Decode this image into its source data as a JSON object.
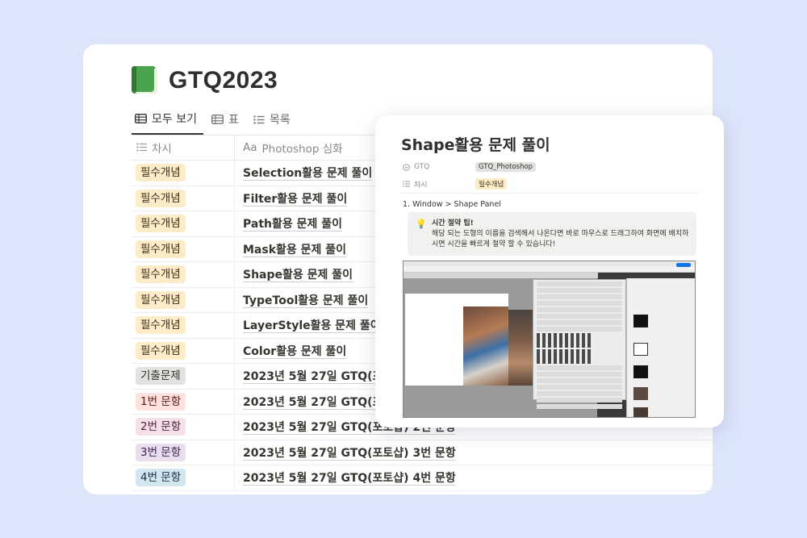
{
  "page": {
    "title": "GTQ2023",
    "icon": "green-book-icon"
  },
  "tabs": [
    {
      "label": "모두 보기",
      "icon": "table-icon",
      "active": true
    },
    {
      "label": "표",
      "icon": "table-icon",
      "active": false
    },
    {
      "label": "목록",
      "icon": "list-icon",
      "active": false
    }
  ],
  "table": {
    "columns": [
      {
        "label": "차시",
        "icon": "list-icon"
      },
      {
        "label": "Photoshop 심화",
        "icon": "text-property-icon",
        "icon_text": "Aa"
      }
    ],
    "rows": [
      {
        "tag": "필수개념",
        "tag_bg": "#fdecc8",
        "tag_fg": "#402c1b",
        "title": "Selection활용 문제 풀이"
      },
      {
        "tag": "필수개념",
        "tag_bg": "#fdecc8",
        "tag_fg": "#402c1b",
        "title": "Filter활용 문제 풀이"
      },
      {
        "tag": "필수개념",
        "tag_bg": "#fdecc8",
        "tag_fg": "#402c1b",
        "title": "Path활용 문제 풀이"
      },
      {
        "tag": "필수개념",
        "tag_bg": "#fdecc8",
        "tag_fg": "#402c1b",
        "title": "Mask활용 문제 풀이"
      },
      {
        "tag": "필수개념",
        "tag_bg": "#fdecc8",
        "tag_fg": "#402c1b",
        "title": "Shape활용 문제 풀이"
      },
      {
        "tag": "필수개념",
        "tag_bg": "#fdecc8",
        "tag_fg": "#402c1b",
        "title": "TypeTool활용 문제 풀이"
      },
      {
        "tag": "필수개념",
        "tag_bg": "#fdecc8",
        "tag_fg": "#402c1b",
        "title": "LayerStyle활용 문제 풀이"
      },
      {
        "tag": "필수개념",
        "tag_bg": "#fdecc8",
        "tag_fg": "#402c1b",
        "title": "Color활용 문제 풀이"
      },
      {
        "tag": "기출문제",
        "tag_bg": "#e3e2e0",
        "tag_fg": "#32302c",
        "title": "2023년 5월 27일 GTQ(포토샵) 기출문제"
      },
      {
        "tag": "1번 문항",
        "tag_bg": "#ffe2dd",
        "tag_fg": "#5d1715",
        "title": "2023년 5월 27일 GTQ(포토샵) 1번 문항"
      },
      {
        "tag": "2번 문항",
        "tag_bg": "#f5e0e9",
        "tag_fg": "#4c2337",
        "title": "2023년 5월 27일 GTQ(포토샵) 2번 문항"
      },
      {
        "tag": "3번 문항",
        "tag_bg": "#e8deee",
        "tag_fg": "#412454",
        "title": "2023년 5월 27일 GTQ(포토샵) 3번 문항"
      },
      {
        "tag": "4번 문항",
        "tag_bg": "#d3e5ef",
        "tag_fg": "#183347",
        "title": "2023년 5월 27일 GTQ(포토샵) 4번 문항"
      }
    ]
  },
  "detail": {
    "title": "Shape활용 문제 풀이",
    "props": [
      {
        "name": "GTQ",
        "icon": "select-icon",
        "value": "GTQ_Photoshop",
        "bg": "#e3e2e0",
        "fg": "#32302c"
      },
      {
        "name": "차시",
        "icon": "list-icon",
        "value": "필수개념",
        "bg": "#fdecc8",
        "fg": "#402c1b"
      }
    ],
    "list_item": "1.  Window > Shape Panel",
    "callout": {
      "icon": "lightbulb-icon",
      "title": "시간 절약 팁!",
      "body": "해당 되는 도형의 이름을 검색해서 나온다면 바로 마우스로 드래그하여 화면에 배치하 시면 시간을 빠르게 절약 할 수 있습니다!"
    },
    "screenshot": "photoshop-shapes-panel-screenshot"
  }
}
